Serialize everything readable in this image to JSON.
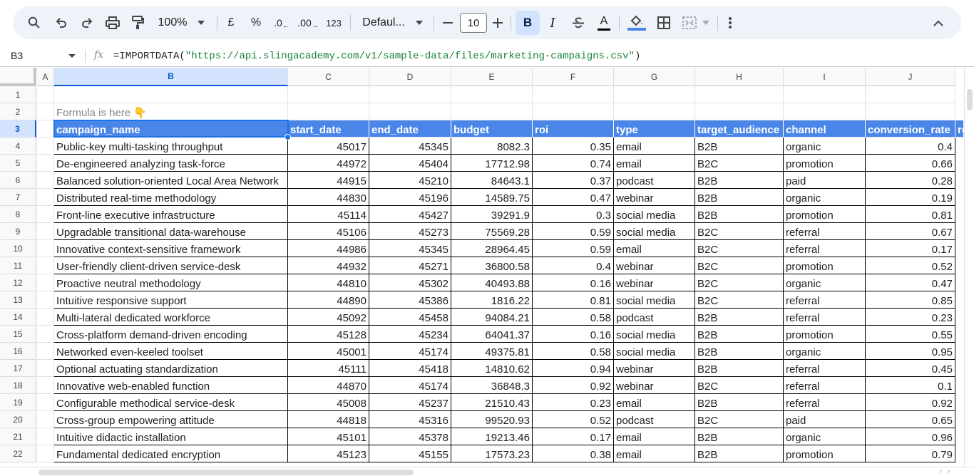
{
  "toolbar": {
    "zoom": "100%",
    "currency": "£",
    "percent": "%",
    "decrease_decimal": ".0",
    "increase_decimal": ".00",
    "number_format": "123",
    "font": "Defaul...",
    "font_size": "10",
    "bold": "B",
    "italic": "I",
    "text_color": "A",
    "accent_color": "#0b57d0"
  },
  "formula_bar": {
    "cell_ref": "B3",
    "fx": "fx",
    "formula_prefix": "=IMPORTDATA(",
    "formula_string": "\"https://api.slingacademy.com/v1/sample-data/files/marketing-campaigns.csv\"",
    "formula_suffix": ")"
  },
  "columns": [
    "A",
    "B",
    "C",
    "D",
    "E",
    "F",
    "G",
    "H",
    "I",
    "J"
  ],
  "rows": [
    "1",
    "2",
    "3",
    "4",
    "5",
    "6",
    "7",
    "8",
    "9",
    "10",
    "11",
    "12",
    "13",
    "14",
    "15",
    "16",
    "17",
    "18",
    "19",
    "20",
    "21",
    "22"
  ],
  "note": "Formula is here 👇",
  "headers": [
    "campaign_name",
    "start_date",
    "end_date",
    "budget",
    "roi",
    "type",
    "target_audience",
    "channel",
    "conversion_rate",
    "re"
  ],
  "data": [
    [
      "Public-key multi-tasking throughput",
      "45017",
      "45345",
      "8082.3",
      "0.35",
      "email",
      "B2B",
      "organic",
      "0.4"
    ],
    [
      "De-engineered analyzing task-force",
      "44972",
      "45404",
      "17712.98",
      "0.74",
      "email",
      "B2C",
      "promotion",
      "0.66"
    ],
    [
      "Balanced solution-oriented Local Area Network",
      "44915",
      "45210",
      "84643.1",
      "0.37",
      "podcast",
      "B2B",
      "paid",
      "0.28"
    ],
    [
      "Distributed real-time methodology",
      "44830",
      "45196",
      "14589.75",
      "0.47",
      "webinar",
      "B2B",
      "organic",
      "0.19"
    ],
    [
      "Front-line executive infrastructure",
      "45114",
      "45427",
      "39291.9",
      "0.3",
      "social media",
      "B2B",
      "promotion",
      "0.81"
    ],
    [
      "Upgradable transitional data-warehouse",
      "45106",
      "45273",
      "75569.28",
      "0.59",
      "social media",
      "B2C",
      "referral",
      "0.67"
    ],
    [
      "Innovative context-sensitive framework",
      "44986",
      "45345",
      "28964.45",
      "0.59",
      "email",
      "B2C",
      "referral",
      "0.17"
    ],
    [
      "User-friendly client-driven service-desk",
      "44932",
      "45271",
      "36800.58",
      "0.4",
      "webinar",
      "B2C",
      "promotion",
      "0.52"
    ],
    [
      "Proactive neutral methodology",
      "44810",
      "45302",
      "40493.88",
      "0.16",
      "webinar",
      "B2C",
      "organic",
      "0.47"
    ],
    [
      "Intuitive responsive support",
      "44890",
      "45386",
      "1816.22",
      "0.81",
      "social media",
      "B2C",
      "referral",
      "0.85"
    ],
    [
      "Multi-lateral dedicated workforce",
      "45092",
      "45458",
      "94084.21",
      "0.58",
      "podcast",
      "B2B",
      "referral",
      "0.23"
    ],
    [
      "Cross-platform demand-driven encoding",
      "45128",
      "45234",
      "64041.37",
      "0.16",
      "social media",
      "B2B",
      "promotion",
      "0.55"
    ],
    [
      "Networked even-keeled toolset",
      "45001",
      "45174",
      "49375.81",
      "0.58",
      "social media",
      "B2B",
      "organic",
      "0.95"
    ],
    [
      "Optional actuating standardization",
      "45111",
      "45418",
      "14810.62",
      "0.94",
      "webinar",
      "B2B",
      "referral",
      "0.45"
    ],
    [
      "Innovative web-enabled function",
      "44870",
      "45174",
      "36848.3",
      "0.92",
      "webinar",
      "B2C",
      "referral",
      "0.1"
    ],
    [
      "Configurable methodical service-desk",
      "45008",
      "45237",
      "21510.43",
      "0.23",
      "email",
      "B2B",
      "referral",
      "0.92"
    ],
    [
      "Cross-group empowering attitude",
      "44818",
      "45316",
      "99520.93",
      "0.52",
      "podcast",
      "B2C",
      "paid",
      "0.65"
    ],
    [
      "Intuitive didactic installation",
      "45101",
      "45378",
      "19213.46",
      "0.17",
      "email",
      "B2B",
      "organic",
      "0.96"
    ],
    [
      "Fundamental dedicated encryption",
      "45123",
      "45155",
      "17573.23",
      "0.38",
      "email",
      "B2B",
      "promotion",
      "0.79"
    ]
  ],
  "colors": {
    "header_fill": "#4a86e8",
    "selection": "#1a73e8",
    "string_green": "#188038"
  }
}
